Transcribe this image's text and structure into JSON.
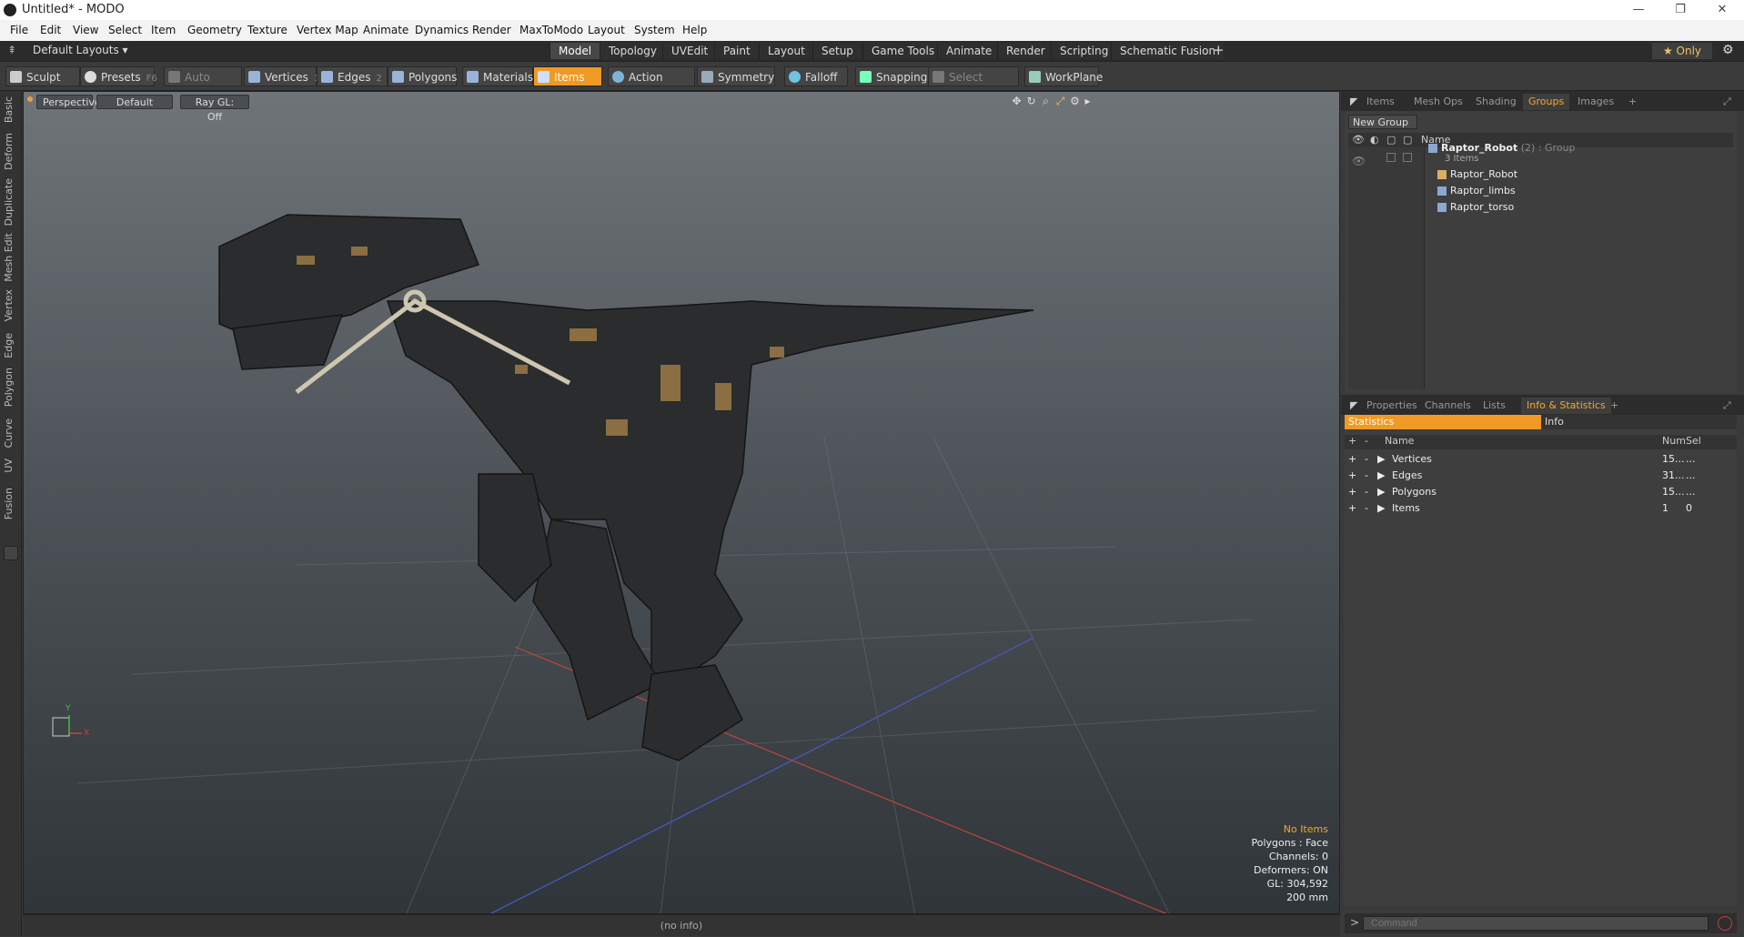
{
  "window": {
    "title": "Untitled* - MODO",
    "minimize": "—",
    "maximize": "❐",
    "close": "✕"
  },
  "menu": [
    "File",
    "Edit",
    "View",
    "Select",
    "Item",
    "Geometry",
    "Texture",
    "Vertex Map",
    "Animate",
    "Dynamics",
    "Render",
    "MaxToModo",
    "Layout",
    "System",
    "Help"
  ],
  "layouts": {
    "label": "Default Layouts ▾"
  },
  "mode_tabs": [
    {
      "label": "Model",
      "active": true
    },
    {
      "label": "Topology"
    },
    {
      "label": "UVEdit"
    },
    {
      "label": "Paint"
    },
    {
      "label": "Layout"
    },
    {
      "label": "Setup"
    },
    {
      "label": "Game Tools"
    },
    {
      "label": "Animate"
    },
    {
      "label": "Render"
    },
    {
      "label": "Scripting"
    },
    {
      "label": "Schematic Fusion"
    }
  ],
  "only_label": "★  Only",
  "toolbar": {
    "sculpt": "Sculpt",
    "presets": "Presets",
    "presets_key": "F6",
    "auto_select": "Auto Select",
    "vertices": "Vertices",
    "vertices_key": "1",
    "edges": "Edges",
    "edges_key": "2",
    "polygons": "Polygons",
    "materials": "Materials",
    "items": "Items",
    "action_center": "Action Center",
    "symmetry": "Symmetry",
    "falloff": "Falloff",
    "snapping": "Snapping",
    "select_through": "Select Through",
    "workplane": "WorkPlane"
  },
  "left_tabs": [
    "Basic",
    "Deform",
    "Duplicate",
    "Mesh Edit",
    "Vertex",
    "Edge",
    "Polygon",
    "Curve",
    "UV",
    "Fusion"
  ],
  "viewport": {
    "view": "Perspective",
    "style": "Default",
    "raygl": "Ray GL: Off",
    "stats": {
      "items": "No Items",
      "polygons": "Polygons : Face",
      "channels": "Channels: 0",
      "deformers": "Deformers: ON",
      "gl": "GL: 304,592",
      "size": "200 mm"
    },
    "axis": {
      "x": "X",
      "y": "Y"
    }
  },
  "statusbar": "(no info)",
  "groups_panel": {
    "tabs": [
      {
        "label": "Items"
      },
      {
        "label": "Mesh Ops"
      },
      {
        "label": "Shading"
      },
      {
        "label": "Groups",
        "active": true
      },
      {
        "label": "Images"
      }
    ],
    "new_group": "New Group",
    "name_header": "Name",
    "group": {
      "name": "Raptor_Robot",
      "count": "(2)",
      "type": ": Group",
      "sub": "3 Items"
    },
    "children": [
      "Raptor_Robot",
      "Raptor_limbs",
      "Raptor_torso"
    ]
  },
  "info_panel": {
    "tabs": [
      {
        "label": "Properties"
      },
      {
        "label": "Channels"
      },
      {
        "label": "Lists"
      },
      {
        "label": "Info & Statistics",
        "active": true
      }
    ],
    "subtabs": {
      "statistics": "Statistics",
      "info": "Info"
    },
    "headers": {
      "name": "Name",
      "num": "Num",
      "sel": "Sel"
    },
    "rows": [
      {
        "name": "Vertices",
        "num": "15...",
        "sel": "..."
      },
      {
        "name": "Edges",
        "num": "31...",
        "sel": "..."
      },
      {
        "name": "Polygons",
        "num": "15...",
        "sel": "..."
      },
      {
        "name": "Items",
        "num": "1",
        "sel": "0"
      }
    ]
  },
  "command": {
    "placeholder": "Command"
  },
  "colors": {
    "accent": "#f09a26",
    "panel": "#3a3a3a"
  }
}
